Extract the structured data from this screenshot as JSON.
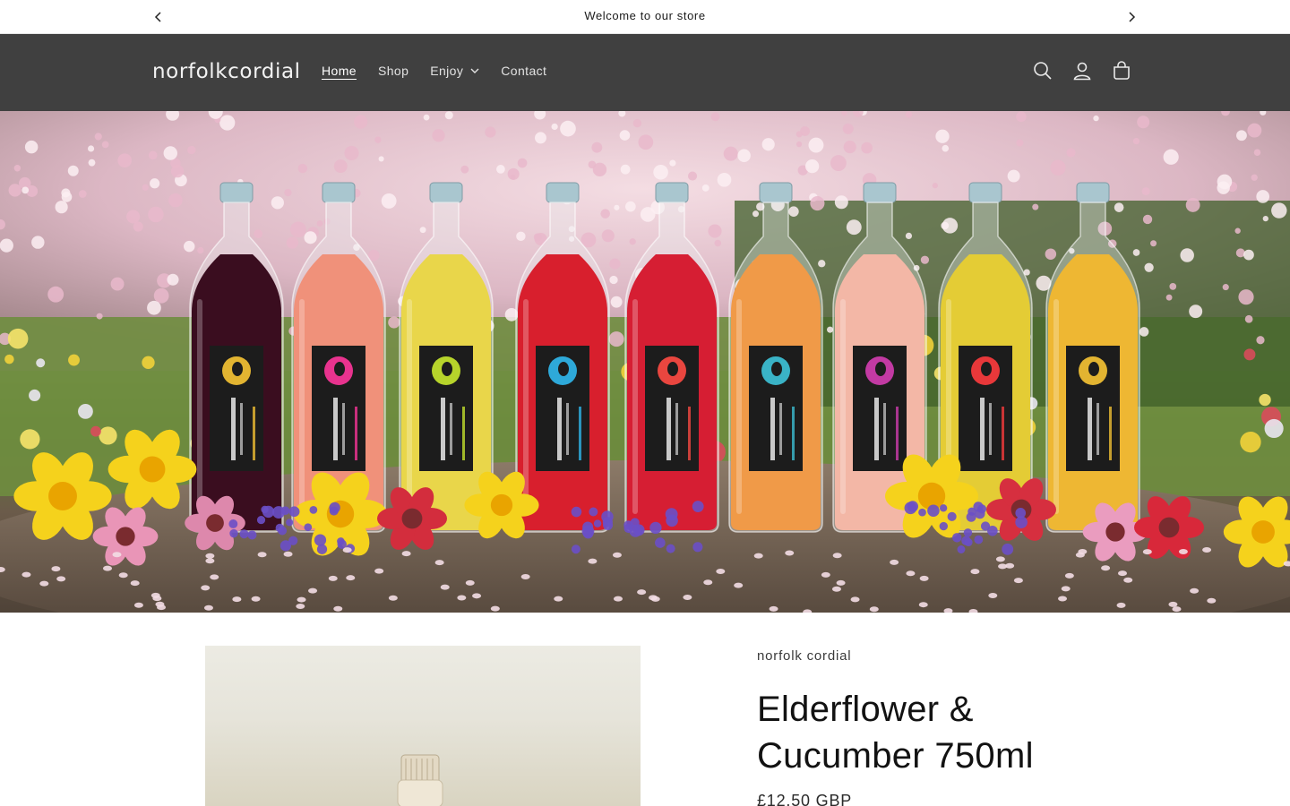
{
  "announcement": {
    "message": "Welcome to our store",
    "prev_icon": "chevron-left-icon",
    "next_icon": "chevron-right-icon"
  },
  "header": {
    "logo": "norfolkcordial",
    "nav": [
      {
        "label": "Home",
        "active": true
      },
      {
        "label": "Shop",
        "active": false
      },
      {
        "label": "Enjoy",
        "active": false,
        "has_dropdown": true
      },
      {
        "label": "Contact",
        "active": false
      }
    ],
    "icons": [
      "search-icon",
      "account-icon",
      "cart-icon"
    ],
    "colors": {
      "background": "#404040",
      "text": "#e2e2e2"
    }
  },
  "hero": {
    "description_icon": "hero-image",
    "bottle_liquid_colors": [
      "#3a0d1f",
      "#f0917a",
      "#e9d64a",
      "#d81f2d",
      "#d61e33",
      "#f09a48",
      "#f3b7a6",
      "#e4cc35",
      "#eeb733"
    ],
    "label_accent_colors": [
      "#e2b431",
      "#e8338e",
      "#b7d42b",
      "#2ea9d9",
      "#e9463f",
      "#3ab3c6",
      "#c23aa3",
      "#e8383a",
      "#e2b431"
    ]
  },
  "product": {
    "vendor": "norfolk cordial",
    "title": "Elderflower & Cucumber 750ml",
    "price": "£12.50 GBP"
  }
}
